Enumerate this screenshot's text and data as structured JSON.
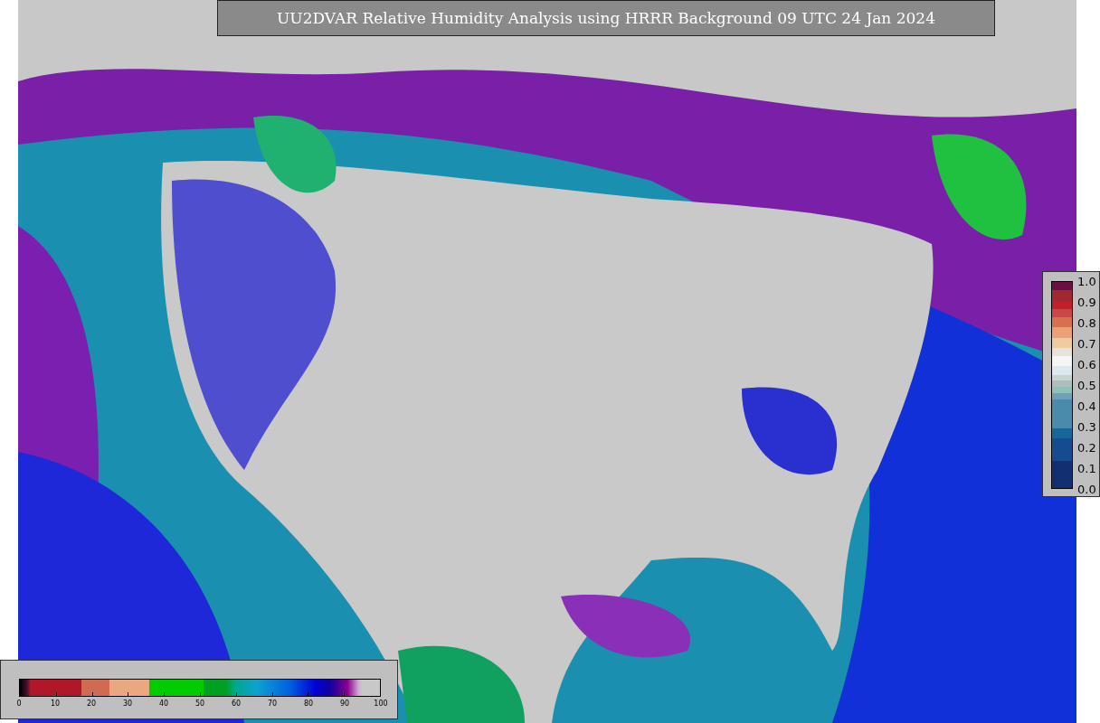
{
  "title": "UU2DVAR Relative Humidity Analysis using HRRR Background 09 UTC 24 Jan 2024",
  "humidity_colorbar": {
    "ticks": [
      "0",
      "10",
      "20",
      "30",
      "40",
      "50",
      "60",
      "70",
      "80",
      "90",
      "100"
    ]
  },
  "ratio_colorbar": {
    "ticks": [
      "1.0",
      "0.9",
      "0.8",
      "0.7",
      "0.6",
      "0.5",
      "0.4",
      "0.3",
      "0.2",
      "0.1",
      "0.0"
    ]
  }
}
